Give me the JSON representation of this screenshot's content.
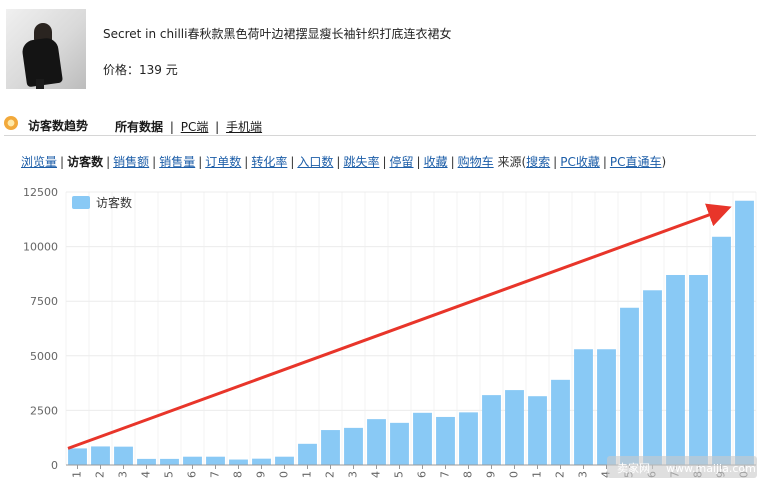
{
  "product": {
    "name": "Secret in chilli春秋款黑色荷叶边裙摆显瘦长袖针织打底连衣裙女",
    "price": "价格：139 元"
  },
  "section": {
    "title": "访客数趋势",
    "tabs": {
      "all": "所有数据",
      "pc": "PC端",
      "mobile": "手机端",
      "sep": "|"
    }
  },
  "metrics": {
    "items": [
      {
        "label": "浏览量",
        "active": false
      },
      {
        "label": "访客数",
        "active": true
      },
      {
        "label": "销售额",
        "active": false
      },
      {
        "label": "销售量",
        "active": false
      },
      {
        "label": "订单数",
        "active": false
      },
      {
        "label": "转化率",
        "active": false
      },
      {
        "label": "入口数",
        "active": false
      },
      {
        "label": "跳失率",
        "active": false
      },
      {
        "label": "停留",
        "active": false
      },
      {
        "label": "收藏",
        "active": false
      },
      {
        "label": "购物车",
        "active": false
      }
    ],
    "source_prefix": "来源(",
    "source_links": [
      "搜索",
      "PC收藏",
      "PC直通车"
    ],
    "source_suffix": ")",
    "sep": "|"
  },
  "chart_data": {
    "type": "bar",
    "categories": [
      "1",
      "2",
      "3",
      "4",
      "5",
      "6",
      "7",
      "8",
      "9",
      "0",
      "1",
      "2",
      "3",
      "4",
      "5",
      "6",
      "7",
      "8",
      "9",
      "0",
      "1",
      "2",
      "3",
      "4",
      "5",
      "6",
      "7",
      "8",
      "9",
      "0"
    ],
    "series": [
      {
        "name": "访客数",
        "color": "#89c9f5",
        "values": [
          760,
          850,
          840,
          280,
          280,
          380,
          380,
          250,
          290,
          380,
          970,
          1600,
          1700,
          2100,
          1930,
          2390,
          2200,
          2410,
          3200,
          3430,
          3150,
          3900,
          5300,
          5300,
          7200,
          8000,
          8700,
          8700,
          10450,
          12100
        ]
      }
    ],
    "ylim": [
      0,
      12500
    ],
    "yticks": [
      0,
      2500,
      5000,
      7500,
      10000,
      12500
    ],
    "grid": true,
    "legend": "top-left",
    "annotation": {
      "type": "arrow",
      "color": "#e8352a",
      "direction": "rising"
    }
  },
  "watermark": {
    "brand": "卖家网",
    "url": "www.maijia.com"
  }
}
